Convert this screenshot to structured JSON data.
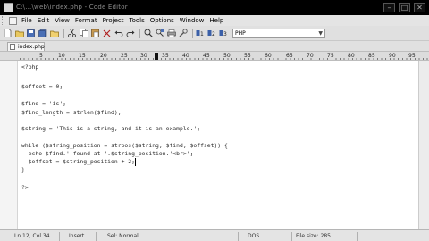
{
  "window": {
    "title": "C:\\...\\web\\index.php - Code Editor",
    "min_label": "–",
    "max_label": "□",
    "close_label": "✕"
  },
  "menu": {
    "items": [
      "File",
      "Edit",
      "View",
      "Format",
      "Project",
      "Tools",
      "Options",
      "Window",
      "Help"
    ]
  },
  "toolbar": {
    "language": "PHP",
    "icons": [
      "new-file-icon",
      "open-folder-icon",
      "save-icon",
      "save-all-icon",
      "open-icon",
      "cut-icon",
      "copy-icon",
      "paste-icon",
      "delete-icon",
      "undo-icon",
      "redo-icon",
      "find-icon",
      "replace-icon",
      "print-icon",
      "settings-icon",
      "bookmark-toggle-icon",
      "bookmark-prev-icon",
      "bookmark-next-icon"
    ]
  },
  "tabs": [
    {
      "label": "index.php"
    }
  ],
  "ruler": {
    "marks": [
      "5",
      "10",
      "15",
      "20",
      "25",
      "30",
      "35",
      "40",
      "45",
      "50",
      "55",
      "60",
      "65",
      "70",
      "75",
      "80",
      "85",
      "90",
      "95"
    ]
  },
  "code": {
    "lines": [
      "<?php",
      "",
      "$offset = 0;",
      "",
      "$find = 'is';",
      "$find_length = strlen($find);",
      "",
      "$string = 'This is a string, and it is an example.';",
      "",
      "while ($string_position = strpos($string, $find, $offset)) {",
      "  echo $find.' found at '.$string_position.'<br>';",
      "  $offset = $string_position + 2;",
      "}",
      "",
      "",
      "?>"
    ]
  },
  "status": {
    "position": "Ln 12, Col 34",
    "mode": "Insert",
    "selection": "Sel: Normal",
    "encoding": "DOS",
    "file_size": "File size: 285"
  }
}
